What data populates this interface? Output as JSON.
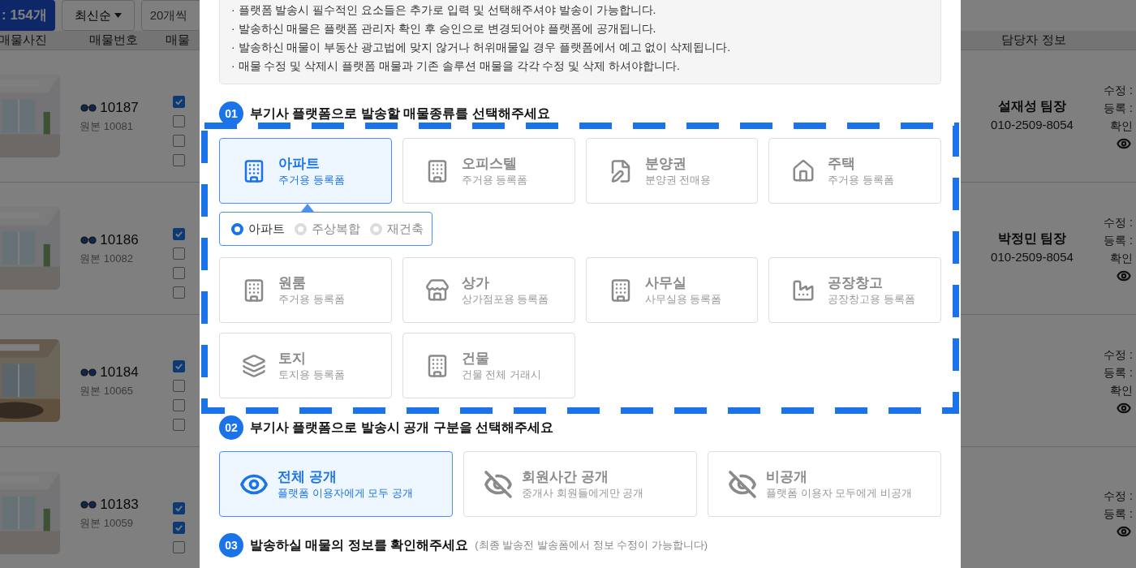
{
  "background": {
    "count_label": ": 154개",
    "sort_label": "최신순",
    "page_size_label": "20개씩",
    "columns": [
      "매물사진",
      "매물번호",
      "매물",
      "담당자 정보"
    ],
    "rows": [
      {
        "number": "10187",
        "original": "원본 10081",
        "options": [
          {
            "checked": true
          },
          {
            "checked": false
          },
          {
            "checked": false
          },
          {
            "checked": false
          }
        ],
        "agent": "설재성 팀장",
        "phone": "010-2509-8054",
        "dates": [
          "수정 :",
          "등록 :",
          "확인"
        ]
      },
      {
        "number": "10186",
        "original": "원본 10082",
        "options": [
          {
            "checked": true
          },
          {
            "checked": false
          },
          {
            "checked": false
          },
          {
            "checked": false
          }
        ],
        "agent": "박정민 팀장",
        "phone": "010-2509-8054",
        "dates": [
          "수정 :",
          "등록 :",
          "확인"
        ]
      },
      {
        "number": "10184",
        "original": "원본 10065",
        "options": [
          {
            "checked": true
          },
          {
            "checked": false
          },
          {
            "checked": false
          },
          {
            "checked": false
          }
        ],
        "dates": [
          "수정 :",
          "등록 :",
          "확인"
        ]
      },
      {
        "number": "10183",
        "original": "원본 10059",
        "options": [
          {
            "checked": true
          },
          {
            "checked": true
          },
          {
            "checked": false
          }
        ],
        "dates": [
          "수정 :",
          "등록 :"
        ]
      }
    ]
  },
  "modal": {
    "notice": [
      "· 플랫폼 발송시 필수적인 요소들은 추가로 입력 및 선택해주셔야 발송이 가능합니다.",
      "· 발송하신 매물은 플랫폼 관리자 확인 후 승인으로 변경되어야 플랫폼에 공개됩니다.",
      "· 발송하신 매물이 부동산 광고법에 맞지 않거나 허위매물일 경우 플랫폼에서 예고 없이 삭제됩니다.",
      "· 매물 수정 및 삭제시 플랫폼 매물과 기존 솔루션 매물을 각각 수정 및 삭제 하셔야합니다."
    ],
    "step1": {
      "number": "01",
      "title": "부기사 플랫폼으로 발송할 매물종류를 선택해주세요",
      "types": [
        {
          "title": "아파트",
          "subtitle": "주거용 등록폼",
          "kind": "building",
          "selected": true
        },
        {
          "title": "오피스텔",
          "subtitle": "주거용 등록폼",
          "kind": "building",
          "selected": false
        },
        {
          "title": "분양권",
          "subtitle": "분양권 전매용",
          "kind": "document",
          "selected": false
        },
        {
          "title": "주택",
          "subtitle": "주거용 등록폼",
          "kind": "house",
          "selected": false
        },
        {
          "title": "원룸",
          "subtitle": "주거용 등록폼",
          "kind": "building",
          "selected": false
        },
        {
          "title": "상가",
          "subtitle": "상가점포용 등록폼",
          "kind": "store",
          "selected": false
        },
        {
          "title": "사무실",
          "subtitle": "사무실용 등록폼",
          "kind": "building",
          "selected": false
        },
        {
          "title": "공장창고",
          "subtitle": "공장창고용 등록폼",
          "kind": "factory",
          "selected": false
        },
        {
          "title": "토지",
          "subtitle": "토지용 등록폼",
          "kind": "land",
          "selected": false
        },
        {
          "title": "건물",
          "subtitle": "건물 전체 거래시",
          "kind": "building",
          "selected": false
        }
      ],
      "subtypes": [
        {
          "label": "아파트",
          "selected": true
        },
        {
          "label": "주상복합",
          "selected": false
        },
        {
          "label": "재건축",
          "selected": false
        }
      ]
    },
    "step2": {
      "number": "02",
      "title": "부기사 플랫폼으로 발송시 공개 구분을 선택해주세요",
      "options": [
        {
          "title": "전체 공개",
          "subtitle": "플랫폼 이용자에게 모두 공개",
          "kind": "public",
          "selected": true
        },
        {
          "title": "회원사간 공개",
          "subtitle": "중개사 회원들에게만 공개",
          "kind": "restricted",
          "selected": false
        },
        {
          "title": "비공개",
          "subtitle": "플랫폼 이용자 모두에게 비공개",
          "kind": "restricted",
          "selected": false
        }
      ]
    },
    "step3": {
      "number": "03",
      "title": "발송하실 매물의 정보를 확인해주세요",
      "note": "(최종 발송전 발송폼에서 정보 수정이 가능합니다)"
    }
  }
}
